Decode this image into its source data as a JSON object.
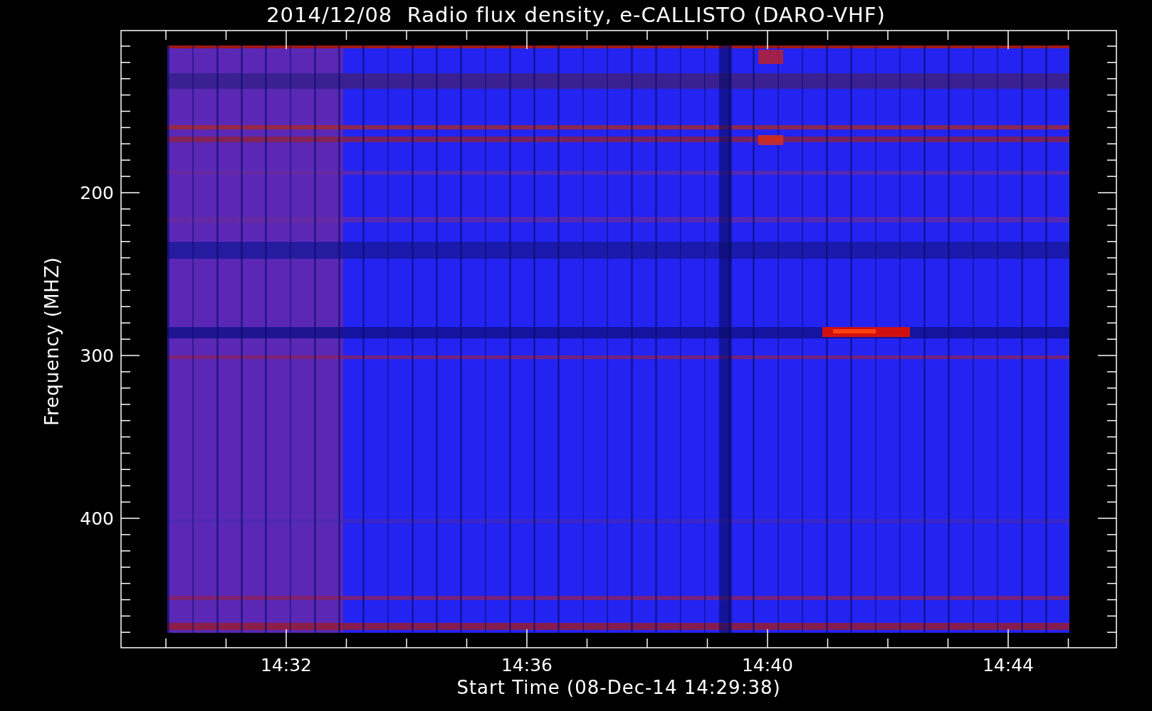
{
  "plot": {
    "title": "2014/12/08  Radio flux density, e-CALLISTO (DARO-VHF)",
    "ylabel": "Frequency (MHZ)",
    "xlabel": "Start Time (08-Dec-14 14:29:38)",
    "yticks": [
      "200",
      "300",
      "400"
    ],
    "xticks": [
      "14:32",
      "14:36",
      "14:40",
      "14:44"
    ]
  }
}
